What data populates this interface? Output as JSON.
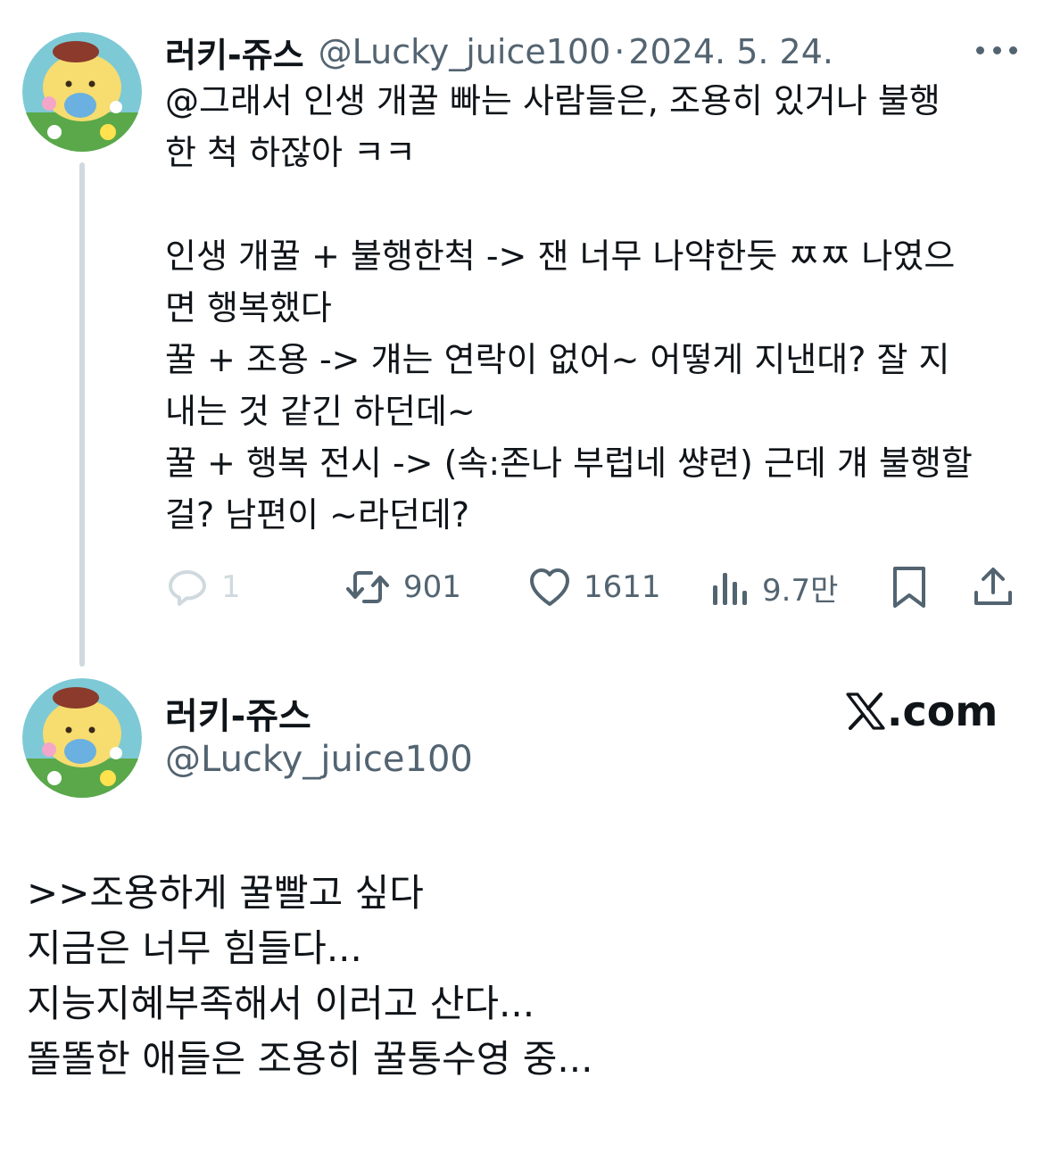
{
  "tweet": {
    "display_name": "러키-쥬스",
    "handle": "@Lucky_juice100",
    "separator": "·",
    "date": "2024. 5. 24.",
    "body_lines": [
      "@그래서 인생 개꿀 빠는 사람들은, 조용히 있거나 불행",
      "한 척 하잖아 ㅋㅋ",
      "",
      "인생 개꿀 + 불행한척 -> 잰 너무 나약한듯 ㅉㅉ 나였으",
      "면 행복했다",
      "꿀 + 조용 -> 걔는 연락이 없어~ 어떻게 지낸대? 잘 지",
      "내는 것 같긴 하던데~",
      "꿀 + 행복 전시 -> (속:존나 부럽네 썅련) 근데 걔 불행할",
      "걸? 남편이 ~라던데?"
    ],
    "actions": {
      "reply_count": "1",
      "retweet_count": "901",
      "like_count": "1611",
      "views_count": "9.7만"
    },
    "icons": {
      "more": "more-icon",
      "reply": "reply-icon",
      "retweet": "retweet-icon",
      "like": "heart-icon",
      "views": "views-icon",
      "bookmark": "bookmark-icon",
      "share": "share-icon"
    }
  },
  "quote_card": {
    "display_name": "러키-쥬스",
    "handle": "@Lucky_juice100",
    "brand": ".com",
    "body_lines": [
      ">>조용하게 꿀빨고 싶다",
      "지금은 너무 힘들다...",
      "지능지혜부족해서 이러고 산다...",
      "똘똘한 애들은 조용히 꿀통수영 중..."
    ]
  },
  "colors": {
    "text_primary": "#0f1419",
    "text_secondary": "#536471",
    "thread_line": "#cfd9de"
  }
}
